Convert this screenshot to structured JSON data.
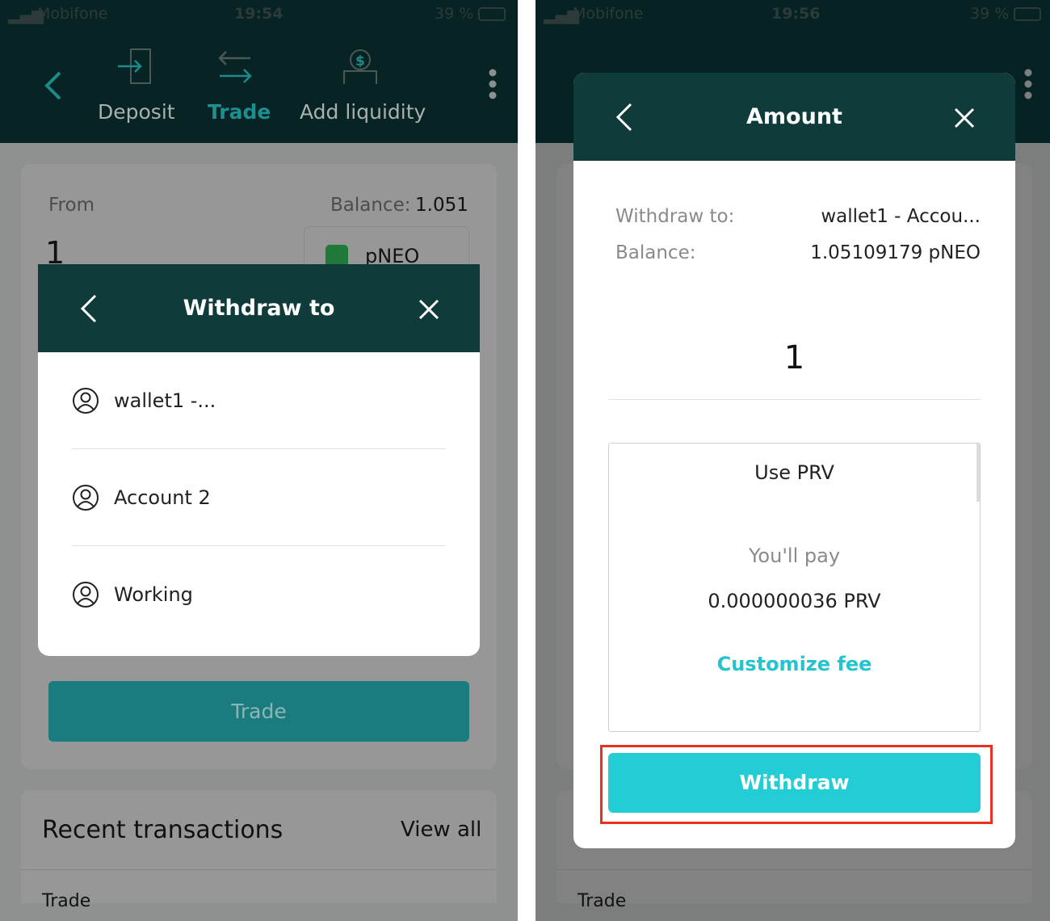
{
  "left": {
    "status": {
      "carrier": "Mobifone",
      "time": "19:54",
      "battery": "39 %"
    },
    "nav": [
      {
        "label": "Deposit",
        "icon": "deposit-icon"
      },
      {
        "label": "Trade",
        "icon": "trade-icon",
        "active": true
      },
      {
        "label": "Add liquidity",
        "icon": "add-liquidity-icon"
      }
    ],
    "form": {
      "from_label": "From",
      "balance_label": "Balance:",
      "balance_value": "1.051",
      "amount": "1",
      "token": "pNEO"
    },
    "trade_button": "Trade",
    "recent": {
      "title": "Recent transactions",
      "view_all": "View all",
      "partial_item": "Trade"
    },
    "modal": {
      "title": "Withdraw to",
      "accounts": [
        "wallet1 -...",
        "Account 2",
        "Working"
      ]
    }
  },
  "right": {
    "status": {
      "carrier": "Mobifone",
      "time": "19:56",
      "battery": "39 %"
    },
    "modal": {
      "title": "Amount",
      "withdraw_to_label": "Withdraw to:",
      "withdraw_to_value": "wallet1 - Accou...",
      "balance_label": "Balance:",
      "balance_value": "1.05109179 pNEO",
      "amount": "1",
      "fee": {
        "title": "Use PRV",
        "pay_label": "You'll pay",
        "pay_value": "0.000000036 PRV",
        "customize": "Customize fee"
      },
      "withdraw_button": "Withdraw"
    },
    "recent": {
      "partial_item": "Trade"
    }
  },
  "colors": {
    "accent": "#23cdd5",
    "header": "#0f3c3b",
    "highlight": "#e8311f"
  }
}
